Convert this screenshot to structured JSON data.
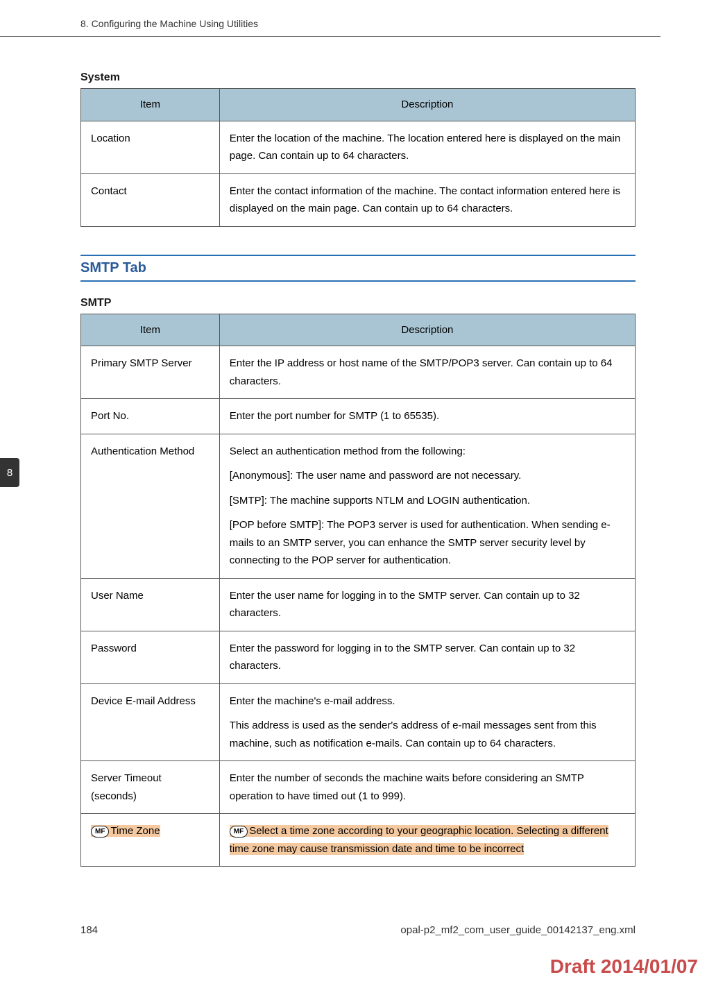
{
  "header": {
    "chapter": "8. Configuring the Machine Using Utilities"
  },
  "tabMarker": "8",
  "systemTable": {
    "title": "System",
    "headers": {
      "item": "Item",
      "description": "Description"
    },
    "rows": [
      {
        "item": "Location",
        "desc": "Enter the location of the machine. The location entered here is displayed on the main page. Can contain up to 64 characters."
      },
      {
        "item": "Contact",
        "desc": "Enter the contact information of the machine. The contact information entered here is displayed on the main page. Can contain up to 64 characters."
      }
    ]
  },
  "sectionHeading": "SMTP Tab",
  "smtpTable": {
    "title": "SMTP",
    "headers": {
      "item": "Item",
      "description": "Description"
    },
    "rows": [
      {
        "item": "Primary SMTP Server",
        "desc": "Enter the IP address or host name of the SMTP/POP3 server. Can contain up to 64 characters."
      },
      {
        "item": "Port No.",
        "desc": "Enter the port number for SMTP (1 to 65535)."
      }
    ],
    "authRow": {
      "item": "Authentication Method",
      "p1": "Select an authentication method from the following:",
      "p2": "[Anonymous]: The user name and password are not necessary.",
      "p3": "[SMTP]: The machine supports NTLM and LOGIN authentication.",
      "p4": "[POP before SMTP]: The POP3 server is used for authentication. When sending e-mails to an SMTP server, you can enhance the SMTP server security level by connecting to the POP server for authentication."
    },
    "rows2": [
      {
        "item": "User Name",
        "desc": "Enter the user name for logging in to the SMTP server. Can contain up to 32 characters."
      },
      {
        "item": "Password",
        "desc": "Enter the password for logging in to the SMTP server. Can contain up to 32 characters."
      }
    ],
    "deviceEmailRow": {
      "item": "Device E-mail Address",
      "p1": "Enter the machine's e-mail address.",
      "p2": "This address is used as the sender's address of e-mail messages sent from this machine, such as notification e-mails. Can contain up to 64 characters."
    },
    "timeoutRow": {
      "item": "Server Timeout (seconds)",
      "desc": "Enter the number of seconds the machine waits before considering an SMTP operation to have timed out (1 to 999)."
    },
    "timezoneRow": {
      "badge": "MF",
      "item": "Time Zone",
      "desc": "Select a time zone according to your geographic location. Selecting a different time zone may cause transmission date and time to be incorrect"
    }
  },
  "footer": {
    "pageNum": "184",
    "filename": "opal-p2_mf2_com_user_guide_00142137_eng.xml"
  },
  "draft": "Draft 2014/01/07"
}
